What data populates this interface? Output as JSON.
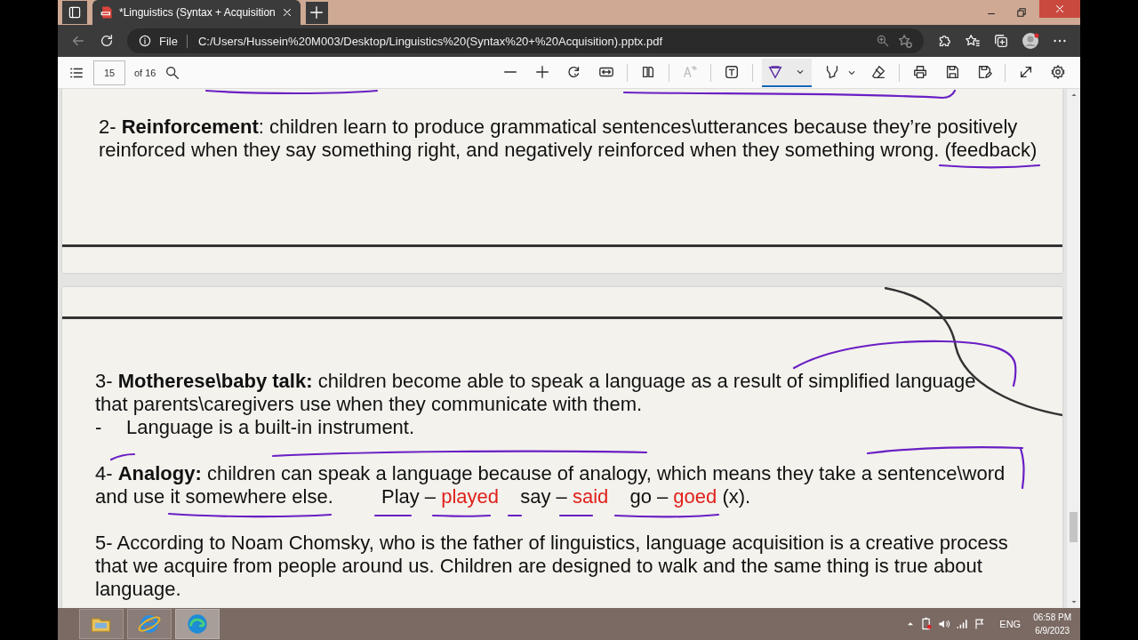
{
  "browser": {
    "tab": {
      "title": "*Linguistics (Syntax + Acquisition",
      "selected": true
    },
    "address": {
      "label": "File",
      "url": "C:/Users/Hussein%20M003/Desktop/Linguistics%20(Syntax%20+%20Acquisition).pptx.pdf"
    }
  },
  "pdf_toolbar": {
    "page_number": "15",
    "page_count": "of 16",
    "tools": [
      {
        "kind": "zoom-out",
        "selected": false
      },
      {
        "kind": "zoom-in",
        "selected": false
      },
      {
        "kind": "rotate",
        "selected": false
      },
      {
        "kind": "fit",
        "selected": false
      },
      {
        "kind": "page-view",
        "selected": false
      },
      {
        "kind": "read-aloud",
        "selected": false,
        "disabled": true
      },
      {
        "kind": "text",
        "selected": false
      },
      {
        "kind": "draw",
        "selected": true
      },
      {
        "kind": "highlight",
        "selected": false
      },
      {
        "kind": "erase",
        "selected": false
      },
      {
        "kind": "print",
        "selected": false
      },
      {
        "kind": "save",
        "selected": false
      },
      {
        "kind": "save-as",
        "selected": false
      },
      {
        "kind": "fullscreen",
        "selected": false
      },
      {
        "kind": "settings",
        "selected": false
      }
    ]
  },
  "pages": [
    {
      "paragraphs": [
        {
          "kind": "text",
          "text": "2- **Reinforcement**: children learn to produce grammatical sentences\\utterances because they’re positively reinforced when they say something right, and negatively reinforced when they something wrong. (feedback)"
        }
      ]
    },
    {
      "paragraphs": [
        {
          "kind": "text",
          "text": "3- **Motherese\\baby talk:** children become able to speak a language as a result of simplified language that parents\\caregivers use when they communicate with them."
        },
        {
          "kind": "bullet",
          "marker": "-",
          "text": "Language is a built-in instrument."
        },
        {
          "kind": "text",
          "text": "4- **Analogy:** children can speak a language because of analogy, which means they take a sentence\\word and use it somewhere else.",
          "examples": [
            {
              "kind": "plain",
              "text": "Play –"
            },
            {
              "kind": "red",
              "text": "played"
            },
            {
              "kind": "plain",
              "text": "say –"
            },
            {
              "kind": "red",
              "text": "said"
            },
            {
              "kind": "plain",
              "text": "go –"
            },
            {
              "kind": "red",
              "text": "goed"
            },
            {
              "kind": "plain",
              "text": "(x)."
            }
          ]
        },
        {
          "kind": "text",
          "text": "5- According to Noam Chomsky, who is the father of linguistics, language acquisition is a creative process that we acquire from people around us. Children are designed to walk and the same thing is true about language."
        }
      ]
    }
  ],
  "taskbar": {
    "apps": [
      {
        "kind": "folder",
        "selected": false
      },
      {
        "kind": "ie",
        "selected": false
      },
      {
        "kind": "edge",
        "selected": true
      }
    ],
    "language": "ENG",
    "time": "06:58 PM",
    "date": "6/9/2023"
  }
}
